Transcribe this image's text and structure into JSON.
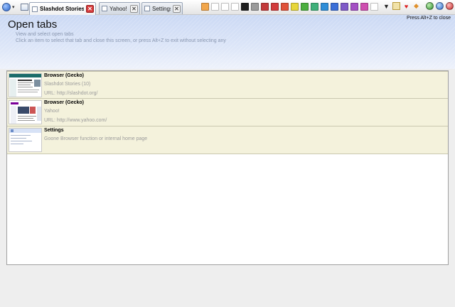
{
  "toolbar": {
    "tabs": [
      {
        "label": "Slashdot Stories (10)",
        "active": true
      },
      {
        "label": "Yahoo!",
        "active": false
      },
      {
        "label": "Settings",
        "active": false
      }
    ],
    "swatch_colors": [
      "#f2a64a",
      "#ffffff",
      "#ffffff",
      "#ffffff",
      "#202020",
      "#9a9a9a",
      "#c33a3a",
      "#d23c3c",
      "#e0523a",
      "#e7d63a",
      "#4caf3f",
      "#3fb07a",
      "#2e8ed8",
      "#3b6fd8",
      "#7f5ac8",
      "#a44fc4",
      "#cf4fb0",
      "#ffffff"
    ],
    "right_icons": [
      "dropdown-arrow-icon",
      "folder-icon",
      "heart-icon",
      "bookmark-icon",
      "green-orb-icon",
      "blue-orb-icon",
      "red-orb-icon"
    ]
  },
  "header": {
    "title": "Open tabs",
    "subtitle": "View and select open tabs",
    "instructions": "Click an item to select that tab and close this screen, or press Alt+Z to exit without selecting any",
    "hint": "Press Alt+Z to close"
  },
  "tab_list": [
    {
      "name": "Browser (Gecko)",
      "description": "Slashdot Stories (10)",
      "url": "URL: http://slashdot.org/",
      "thumb": "slashdot"
    },
    {
      "name": "Browser (Gecko)",
      "description": "Yahoo!",
      "url": "URL: http://www.yahoo.com/",
      "thumb": "yahoo"
    },
    {
      "name": "Settings",
      "description": "Goone Browser function or internal home page",
      "url": "",
      "thumb": "settings"
    }
  ]
}
